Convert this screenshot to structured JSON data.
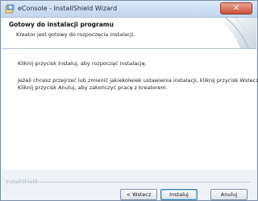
{
  "window": {
    "title": "eConsole - InstallShield Wizard",
    "close_glyph": "✕"
  },
  "header": {
    "title": "Gotowy do instalacji programu",
    "subtitle": "Kreator jest gotowy do rozpoczęcia instalacji."
  },
  "body": {
    "line1": "Kliknij przycisk Instaluj, aby rozpocząć instalację.",
    "line2": "Jeżeli chcesz przejrzeć lub zmienić jakiekolwiek ustawienia instalacji, kliknij przycisk Wstecz.",
    "line3": "Kliknij przycisk Anuluj, aby zakończyć pracę z kreatorem."
  },
  "footer": {
    "brand": "InstallShield",
    "back_label": "< Wstecz",
    "install_label": "Instaluj",
    "cancel_label": "Anuluj"
  },
  "colors": {
    "close_button": "#c9503a",
    "default_button_border": "#3c7fb1"
  }
}
